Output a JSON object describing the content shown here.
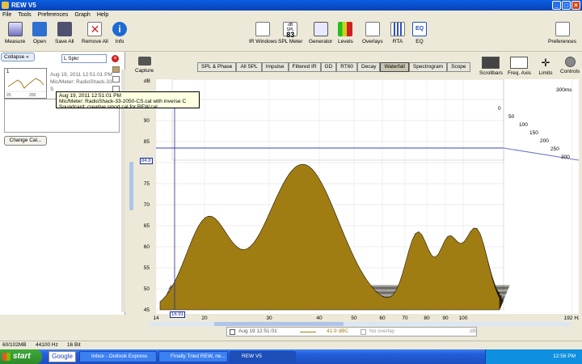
{
  "window": {
    "title": "REW V5"
  },
  "menu": [
    "File",
    "Tools",
    "Preferences",
    "Graph",
    "Help"
  ],
  "toolbar": {
    "left": [
      "Measure",
      "Open",
      "Save All",
      "Remove All",
      "Info"
    ],
    "center": [
      "IR Windows",
      "SPL Meter",
      "Generator",
      "Levels",
      "Overlays",
      "RTA",
      "EQ"
    ],
    "spl_readout": "83",
    "spl_unit": "dB SPL",
    "preferences": "Preferences"
  },
  "left_panel": {
    "collapse_label": "Collapse",
    "name_field": "L Spkr",
    "meas_date": "Aug 19, 2011 12:51:01 PM",
    "meas_mic": "Mic/Meter: RadioShack-33-",
    "meas_sc": "S",
    "thumb_index": "1",
    "thumb_x_min": "20",
    "thumb_x_max": "200",
    "change_cal_label": "Change Cal..."
  },
  "tooltip": {
    "line1": "Aug 19, 2011 12:51:01 PM",
    "line2": "Mic/Meter: RadioShack-33-2050-CS.cal with inverse C",
    "line3": "Soundcard: creative smod cal for REW.cal"
  },
  "capture_label": "Capture",
  "tabs": [
    "SPL & Phase",
    "All SPL",
    "Impulse",
    "Filtered IR",
    "GD",
    "RT60",
    "Decay",
    "Waterfall",
    "Spectrogram",
    "Scope"
  ],
  "active_tab": "Waterfall",
  "right_tools": [
    "Scrollbars",
    "Freq. Axis",
    "Limits",
    "Controls"
  ],
  "graph": {
    "y_unit": "dB",
    "time_unit": "300ms",
    "cursor_freq": "16.91",
    "cursor_level": "84.8",
    "y_ticks": [
      "95",
      "90",
      "85",
      "80",
      "75",
      "70",
      "65",
      "60",
      "55",
      "50",
      "45"
    ],
    "x_ticks": [
      "14",
      "20",
      "30",
      "40",
      "50",
      "60",
      "70",
      "80",
      "90",
      "100",
      "192 Hz"
    ],
    "time_ticks": [
      "0",
      "50",
      "100",
      "150",
      "200",
      "250",
      "300"
    ]
  },
  "legend": {
    "name": "Aug 19 12:51:01",
    "value": "41.9 dBC",
    "overlay": "No overlay",
    "overlay_value": "dB"
  },
  "status": {
    "memory": "60/102MB",
    "rate": "44100 Hz",
    "bits": "16 Bit"
  },
  "taskbar": {
    "start": "start",
    "items": [
      "Inbox - Outlook Express",
      "Finally Tried REW, ne...",
      "REW V5"
    ],
    "google": "Google",
    "clock": "12:56 PM"
  },
  "colors": {
    "fill": "#a07d12",
    "line": "#1a1408",
    "cursor": "#1a2c9a"
  }
}
